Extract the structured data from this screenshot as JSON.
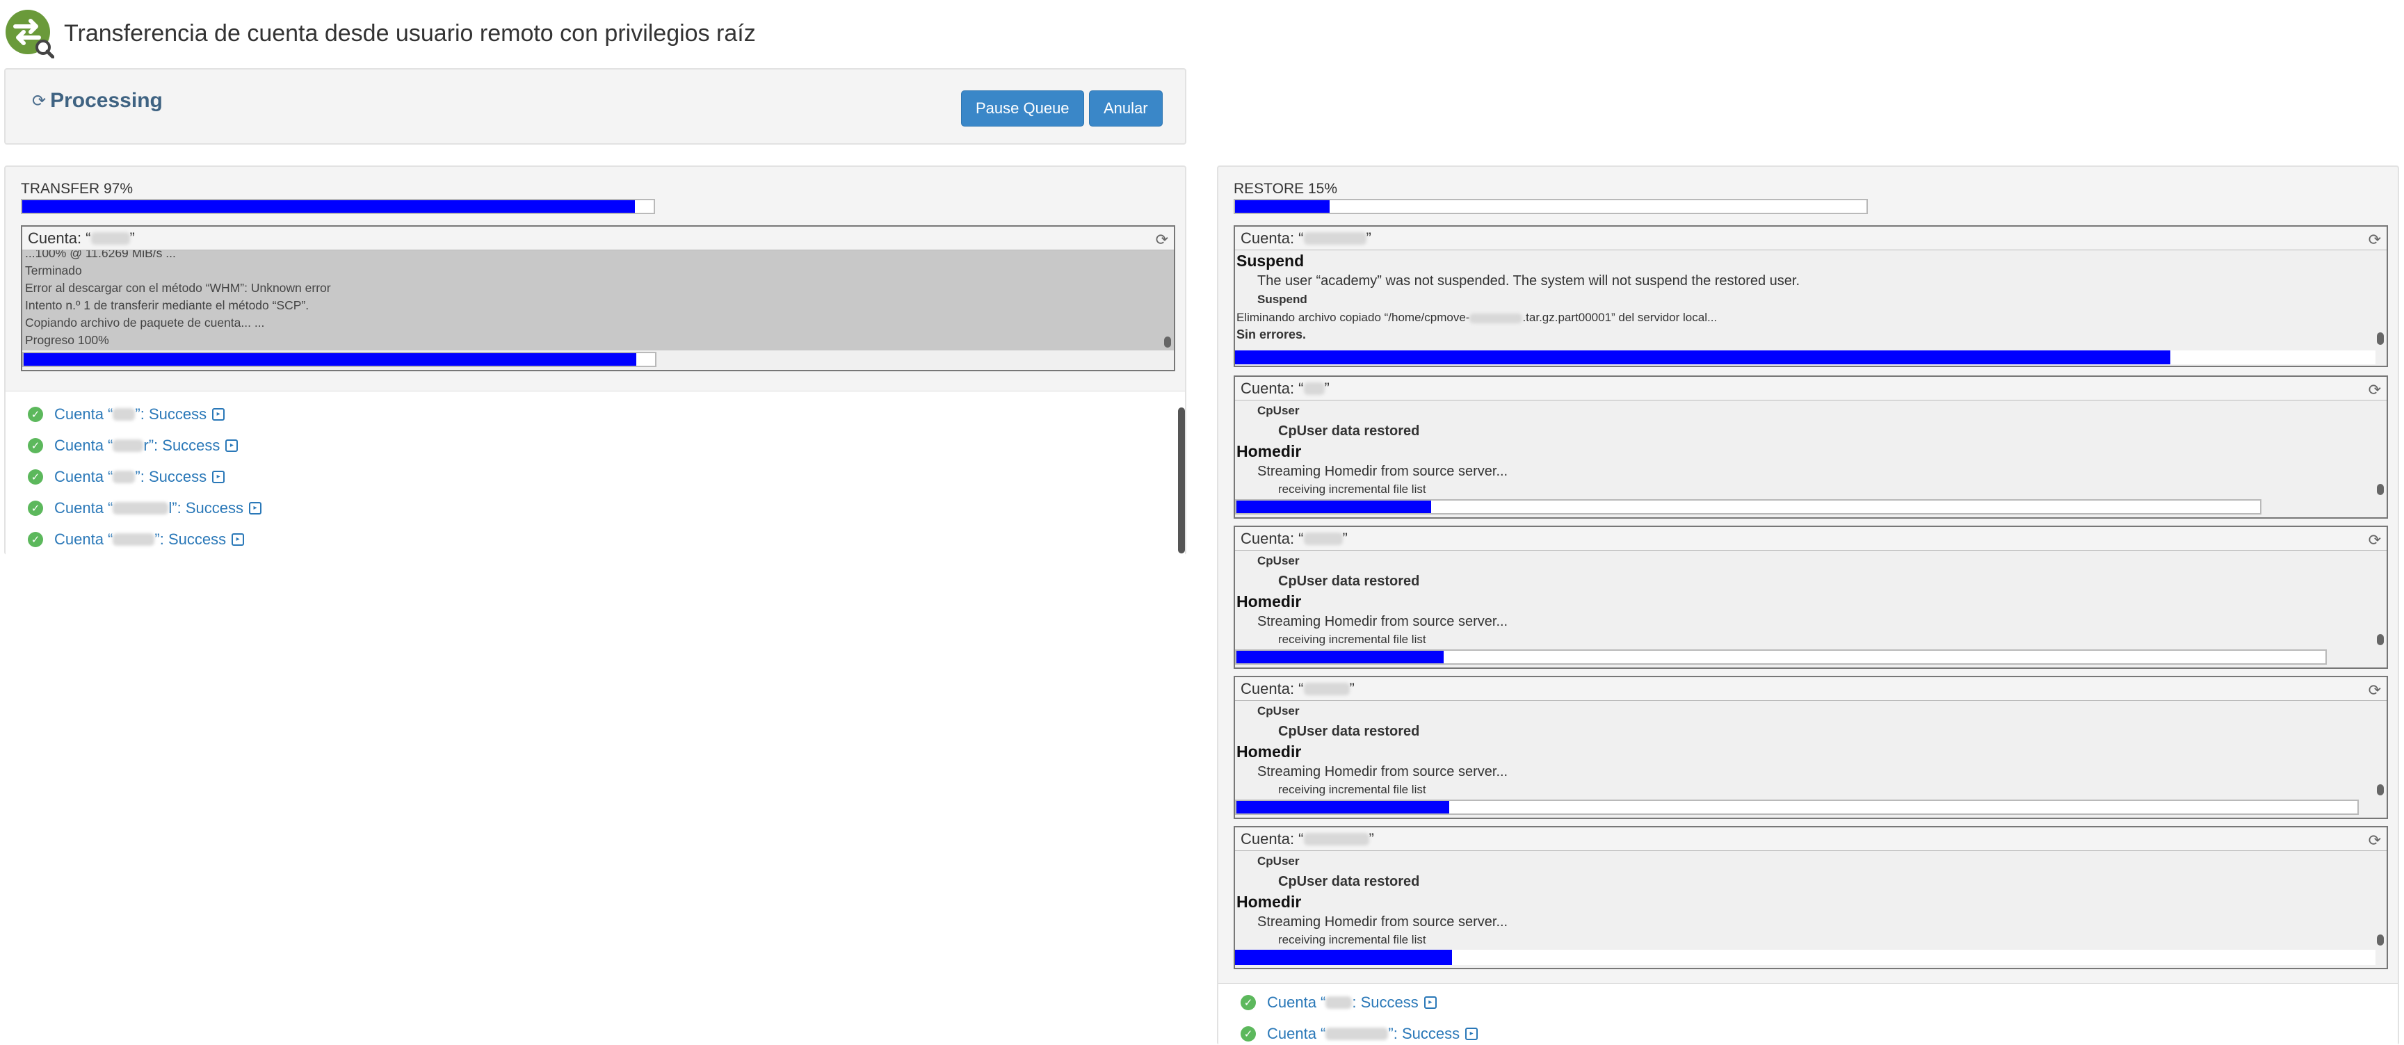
{
  "header": {
    "title": "Transferencia de cuenta desde usuario remoto con privilegios raíz",
    "logo_icon": "transfer-search-icon"
  },
  "processing": {
    "status": "Processing",
    "pause_label": "Pause Queue",
    "cancel_label": "Anular"
  },
  "transfer": {
    "title": "TRANSFER 97%",
    "progress": 0.97,
    "account": {
      "label": "Cuenta: “",
      "label_end": "”",
      "log": [
        "...100% @ 11.6269 MiB/s ...",
        "Terminado",
        "Error al descargar con el método “WHM”: Unknown error",
        "Intento n.º 1 de transferir mediante el método “SCP”.",
        "Copiando archivo de paquete de cuenta... ...",
        "Progreso 100%"
      ],
      "progress": 0.97
    },
    "results": [
      {
        "prefix": "Cuenta “",
        "suffix": "”: Success"
      },
      {
        "prefix": "Cuenta “",
        "suffix": "r”: Success"
      },
      {
        "prefix": "Cuenta “",
        "suffix": "”: Success"
      },
      {
        "prefix": "Cuenta “",
        "suffix": "l”: Success"
      },
      {
        "prefix": "Cuenta “",
        "suffix": "”: Success"
      }
    ]
  },
  "restore": {
    "title": "RESTORE 15%",
    "progress": 0.15,
    "accounts": [
      {
        "label": "Cuenta: “",
        "label_end": "”",
        "suspend_heading": "Suspend",
        "suspend_text": "The user “academy” was not suspended. The system will not suspend the restored user.",
        "suspend_sub": "Suspend",
        "removing_prefix": "Eliminando archivo copiado “/home/cpmove-",
        "removing_suffix": ".tar.gz.part00001” del servidor local...",
        "no_errors": "Sin errores.",
        "progress": 0.82
      },
      {
        "label": "Cuenta: “",
        "label_end": "”",
        "cpuser": "CpUser",
        "cpuser_restored": "CpUser data restored",
        "homedir": "Homedir",
        "streaming": "Streaming Homedir from source server...",
        "receiving": "receiving incremental file list",
        "progress": 0.19
      },
      {
        "label": "Cuenta: “",
        "label_end": "”",
        "cpuser": "CpUser",
        "cpuser_restored": "CpUser data restored",
        "homedir": "Homedir",
        "streaming": "Streaming Homedir from source server...",
        "receiving": "receiving incremental file list",
        "progress": 0.19
      },
      {
        "label": "Cuenta: “",
        "label_end": "”",
        "cpuser": "CpUser",
        "cpuser_restored": "CpUser data restored",
        "homedir": "Homedir",
        "streaming": "Streaming Homedir from source server...",
        "receiving": "receiving incremental file list",
        "progress": 0.19
      },
      {
        "label": "Cuenta: “",
        "label_end": "”",
        "cpuser": "CpUser",
        "cpuser_restored": "CpUser data restored",
        "homedir": "Homedir",
        "streaming": "Streaming Homedir from source server...",
        "receiving": "receiving incremental file list",
        "progress": 0.19
      }
    ],
    "results": [
      {
        "prefix": "Cuenta “",
        "suffix": ": Success"
      },
      {
        "prefix": "Cuenta “",
        "suffix": "”: Success"
      }
    ]
  },
  "colors": {
    "bar_fill": "#0000ff",
    "button": "#3a87c8",
    "link": "#2a78b8",
    "success": "#5cb85c",
    "log_bg": "#c8c8c8"
  }
}
